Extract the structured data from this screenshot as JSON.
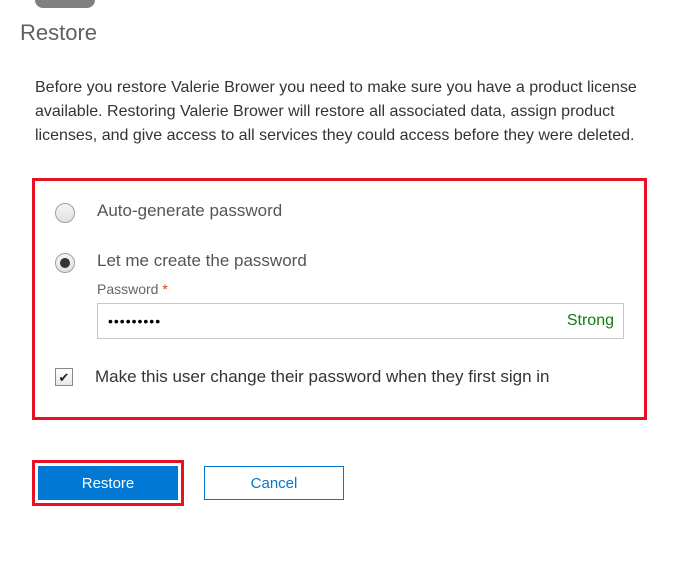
{
  "header": {
    "title": "Restore"
  },
  "main": {
    "description": "Before you restore Valerie Brower you need to make sure you have a product license available. Restoring Valerie Brower will restore all associated data, assign product licenses, and give access to all services they could access before they were deleted."
  },
  "password_options": {
    "auto_label": "Auto-generate password",
    "manual_label": "Let me create the password",
    "field_label": "Password",
    "required_marker": "*",
    "value": "•••••••••",
    "strength": "Strong",
    "force_change_label": "Make this user change their password when they first sign in",
    "selected": "manual",
    "force_change_checked": true
  },
  "footer": {
    "restore_label": "Restore",
    "cancel_label": "Cancel"
  }
}
